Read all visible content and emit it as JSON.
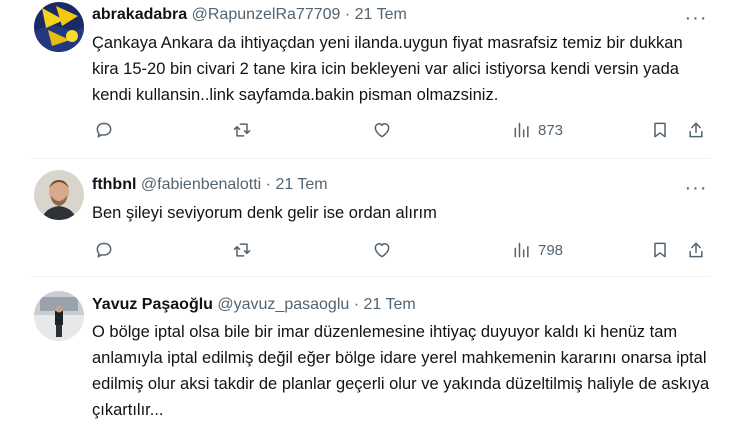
{
  "tweets": [
    {
      "name": "abrakadabra",
      "handle": "@RapunzelRa77709",
      "dot": "·",
      "date": "21 Tem",
      "more": "···",
      "text": "Çankaya Ankara da ihtiyaçdan yeni ilanda.uygun fiyat masrafsiz temiz bir dukkan kira 15-20 bin civari 2 tane kira icin bekleyeni var alici istiyorsa kendi versin yada kendi kullansin..link sayfamda.bakin pisman olmazsiniz.",
      "views": "873"
    },
    {
      "name": "fthbnl",
      "handle": "@fabienbenalotti",
      "dot": "·",
      "date": "21 Tem",
      "more": "···",
      "text": "Ben şileyi seviyorum denk gelir ise ordan alırım",
      "views": "798"
    },
    {
      "name": "Yavuz Paşaoğlu",
      "handle": "@yavuz_pasaoglu",
      "dot": "·",
      "date": "21 Tem",
      "text": "O bölge iptal olsa bile bir imar düzenlemesine ihtiyaç duyuyor kaldı ki henüz tam anlamıyla iptal edilmiş değil eğer bölge idare yerel mahkemenin kararını onarsa iptal edilmiş olur aksi takdir de planlar geçerli olur ve yakında düzeltilmiş haliyle de askıya çıkartılır..."
    }
  ],
  "icons": [
    "reply-icon",
    "retweet-icon",
    "like-icon",
    "views-icon",
    "bookmark-icon",
    "share-icon",
    "more-icon"
  ],
  "colors": {
    "text": "#0f1419",
    "muted": "#536471",
    "divider": "#eff3f4"
  }
}
